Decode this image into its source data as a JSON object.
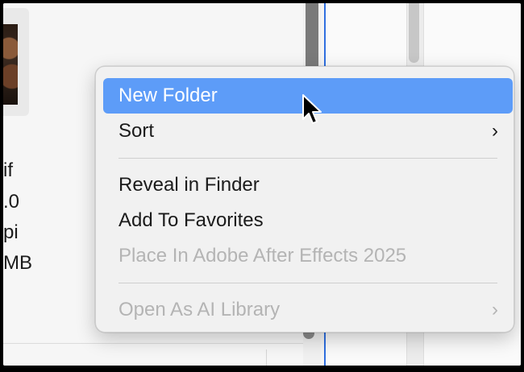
{
  "left_panel": {
    "metadata_lines": [
      "if",
      ".0",
      "pi",
      "MB"
    ]
  },
  "context_menu": {
    "items": [
      {
        "label": "New Folder",
        "state": "selected",
        "submenu": false
      },
      {
        "label": "Sort",
        "state": "enabled",
        "submenu": true
      },
      {
        "label": "Reveal in Finder",
        "state": "enabled",
        "submenu": false
      },
      {
        "label": "Add To Favorites",
        "state": "enabled",
        "submenu": false
      },
      {
        "label": "Place In Adobe After Effects 2025",
        "state": "disabled",
        "submenu": false
      },
      {
        "label": "Open As AI Library",
        "state": "disabled",
        "submenu": true
      }
    ],
    "submenu_glyph": "›",
    "highlight_color": "#5d9cf8",
    "disabled_color": "#b4b4b4"
  },
  "icons": {
    "cursor": "mouse-pointer-icon",
    "submenu": "chevron-right-icon"
  }
}
